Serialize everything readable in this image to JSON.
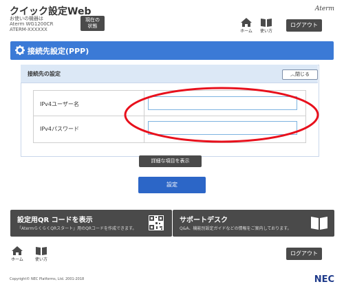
{
  "header": {
    "title": "クイック設定Web",
    "device_label": "お使いの機器は",
    "device_model": "Aterm WG1200CR",
    "device_id": "ATERM-XXXXXX",
    "status_button": {
      "line1": "現在の",
      "line2": "状態"
    },
    "brand": "Aterm",
    "home_label": "ホーム",
    "help_label": "使い方",
    "logout_label": "ログアウト"
  },
  "page": {
    "title": "接続先設定(PPP)"
  },
  "section": {
    "title": "接続先の設定",
    "toggle_label": "閉じる",
    "fields": [
      {
        "label": "IPv4ユーザー名",
        "value": ""
      },
      {
        "label": "IPv4パスワード",
        "value": ""
      }
    ]
  },
  "buttons": {
    "details": "詳細な項目を表示",
    "submit": "設定"
  },
  "cards": {
    "qr": {
      "title": "設定用QR コードを表示",
      "desc": "「AtermらくらくQRスタート」用のQRコードを作成できます。"
    },
    "support": {
      "title": "サポートデスク",
      "desc": "Q&A、機能別設定ガイドなどの情報をご案内しております。"
    }
  },
  "footer": {
    "home_label": "ホーム",
    "help_label": "使い方",
    "logout_label": "ログアウト",
    "copyright": "Copyright© NEC Platforms, Ltd. 2001-2018",
    "logo": "NEC"
  },
  "colors": {
    "accent": "#3b7ad6",
    "button_dark": "#4a4a4a",
    "primary_button": "#2c66c7",
    "annotation_red": "#e8101c"
  }
}
